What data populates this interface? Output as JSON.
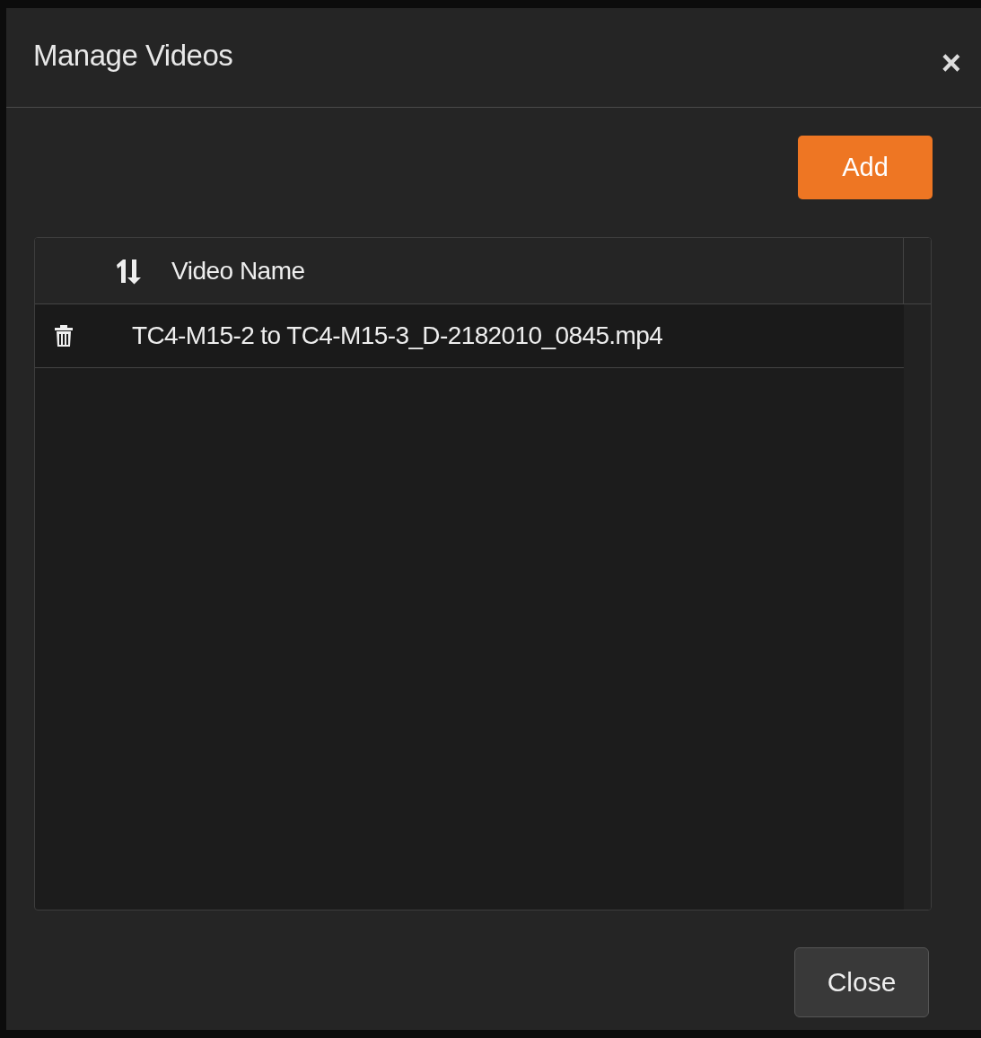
{
  "dialog": {
    "title": "Manage Videos",
    "close_icon": "×"
  },
  "add_button": "Add",
  "table": {
    "columns": [
      {
        "label": "Video Name"
      }
    ],
    "rows": [
      {
        "video_name": "TC4-M15-2 to TC4-M15-3_D-2182010_0845.mp4"
      }
    ]
  },
  "footer": {
    "buttons": [
      "Close"
    ]
  }
}
